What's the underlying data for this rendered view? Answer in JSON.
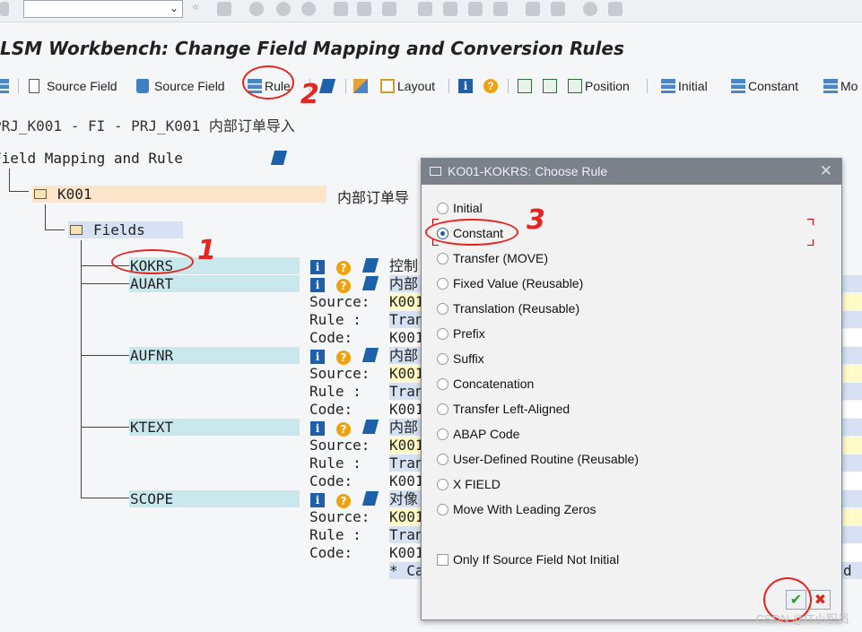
{
  "window": {
    "title": "LSM Workbench: Change Field Mapping and Conversion Rules",
    "command_field_value": ""
  },
  "toolbar": {
    "source_field_label": "Source Field",
    "delete_source_field_label": "Source Field",
    "rule_label": "Rule",
    "layout_label": "Layout",
    "position_label": "Position",
    "initial_label": "Initial",
    "constant_label": "Constant",
    "move_label": "Mo"
  },
  "header_line": "PRJ_K001 - FI - PRJ_K001 内部订单导入",
  "tree": {
    "root_label": "Field Mapping and Rule",
    "object_label": "K001",
    "object_desc": "内部订单导",
    "fields_label": "Fields",
    "source_prefix": "Source:",
    "rule_prefix": "Rule  :",
    "code_prefix": "Code:",
    "fields": [
      {
        "name": "KOKRS",
        "desc": "控制"
      },
      {
        "name": "AUART",
        "desc": "内部",
        "source": "K001",
        "rule": "Tran",
        "code": "K001"
      },
      {
        "name": "AUFNR",
        "desc": "内部",
        "source": "K001",
        "rule": "Tran",
        "code": "K001"
      },
      {
        "name": "KTEXT",
        "desc": "内部",
        "source": "K001",
        "rule": "Tran",
        "code": "K001"
      },
      {
        "name": "SCOPE",
        "desc": "对像",
        "source": "K001",
        "rule": "Tran",
        "code": "K001"
      }
    ],
    "trailing_comment": "* Ca",
    "trailing_right": "d"
  },
  "dialog": {
    "title": "KO01-KOKRS: Choose Rule",
    "options": [
      "Initial",
      "Constant",
      "Transfer (MOVE)",
      "Fixed Value (Reusable)",
      "Translation (Reusable)",
      "Prefix",
      "Suffix",
      "Concatenation",
      "Transfer Left-Aligned",
      "ABAP Code",
      "User-Defined Routine (Reusable)",
      "X FIELD",
      "Move With Leading Zeros"
    ],
    "selected_option": "Constant",
    "checkbox_label": "Only If Source Field Not Initial",
    "checkbox_checked": false,
    "ok_icon": "green-check-icon",
    "cancel_icon": "red-x-icon"
  },
  "annotations": {
    "step1": "1",
    "step2": "2",
    "step3": "3"
  },
  "watermark": "CSDN @IT小职员",
  "colors": {
    "annotation": "#e8231f",
    "field_bg": "#c9e8ee",
    "selected_radio": "#1f5fa8"
  }
}
